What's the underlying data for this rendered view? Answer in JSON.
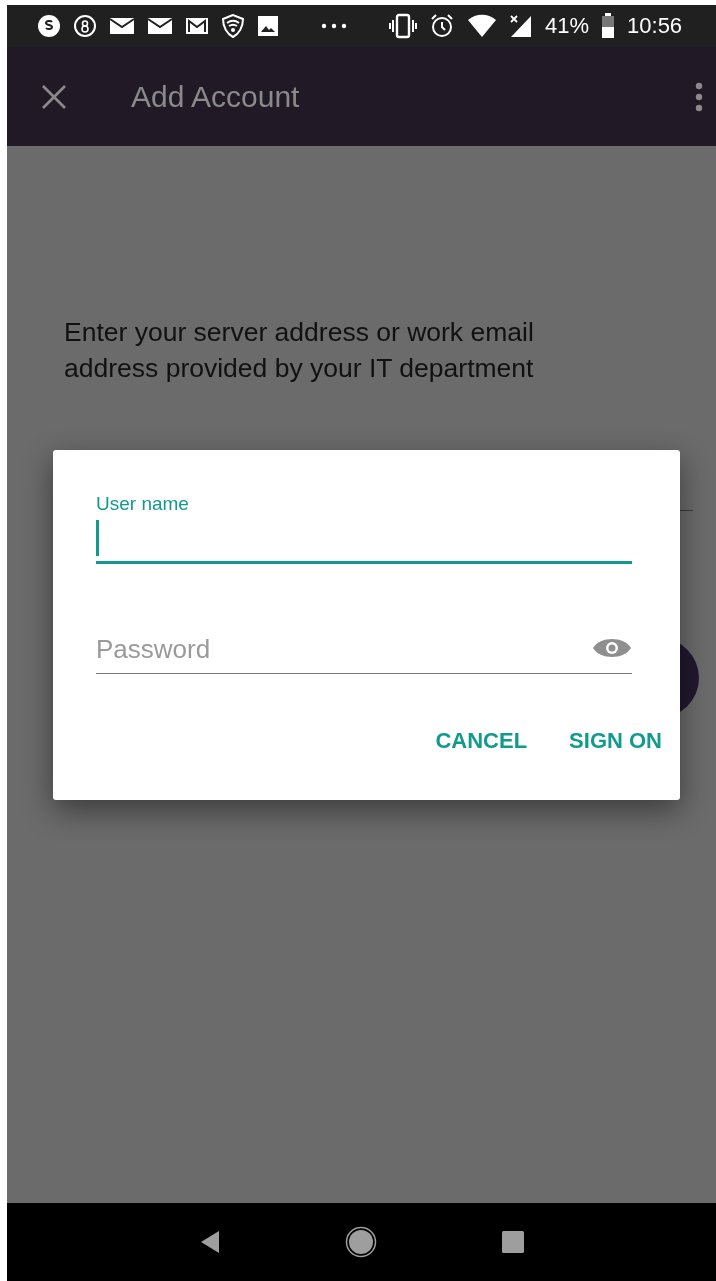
{
  "status_bar": {
    "battery": "41%",
    "time": "10:56"
  },
  "app_bar": {
    "title": "Add Account"
  },
  "instructions": "Enter your server address or work email address provided by your IT department",
  "dialog": {
    "fields": [
      {
        "kind": "text",
        "label": "User name",
        "focused": true
      },
      {
        "kind": "password",
        "placeholder": "Password",
        "focused": false,
        "reveal_toggle": true
      }
    ],
    "buttons": [
      "CANCEL",
      "SIGN ON"
    ]
  }
}
